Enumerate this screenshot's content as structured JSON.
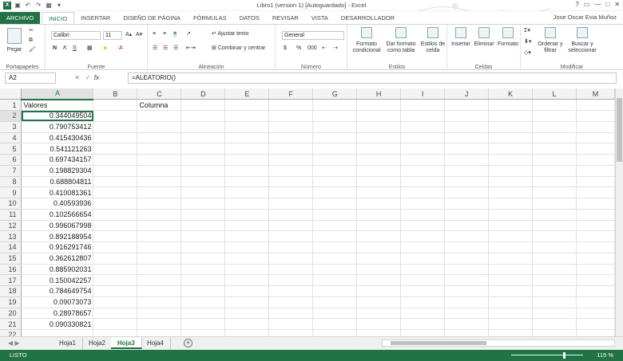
{
  "window": {
    "title": "Libro1 (version 1) [Autoguardado] - Excel",
    "user": "Jose Oscar Evia Muñoz",
    "controls": [
      "?",
      "▭",
      "—",
      "□",
      "✕"
    ]
  },
  "quick_access": [
    "excel-icon",
    "save-icon",
    "undo-icon",
    "redo-icon",
    "table-icon",
    "customize-icon"
  ],
  "ribbon_tabs": [
    "ARCHIVO",
    "INICIO",
    "INSERTAR",
    "DISEÑO DE PÁGINA",
    "FÓRMULAS",
    "DATOS",
    "REVISAR",
    "VISTA",
    "DESARROLLADOR"
  ],
  "ribbon": {
    "clipboard": {
      "label": "Portapapeles",
      "paste": "Pegar"
    },
    "font": {
      "label": "Fuente",
      "name": "Calibri",
      "size": "11",
      "bold": "N",
      "italic": "K",
      "underline": "S"
    },
    "alignment": {
      "label": "Alineación",
      "wrap": "Ajustar texto",
      "merge": "Combinar y centrar"
    },
    "number": {
      "label": "Número",
      "format": "General",
      "currency": "$",
      "percent": "%",
      "thousands": "000"
    },
    "styles": {
      "label": "Estilos",
      "conditional": "Formato condicional",
      "as_table": "Dar formato como tabla",
      "cell_styles": "Estilos de celda"
    },
    "cells": {
      "label": "Celdas",
      "insert": "Insertar",
      "delete": "Eliminar",
      "format": "Formato"
    },
    "editing": {
      "label": "Modificar",
      "sort": "Ordenar y filtrar",
      "find": "Buscar y seleccionar"
    }
  },
  "formula_bar": {
    "name_box": "A2",
    "fx": "fx",
    "formula": "=ALEATORIO()"
  },
  "columns": [
    "A",
    "B",
    "C",
    "D",
    "E",
    "F",
    "G",
    "H",
    "I",
    "J",
    "K",
    "L",
    "M"
  ],
  "rows": [
    {
      "n": "1",
      "a": "Valores",
      "c": "Columna"
    },
    {
      "n": "2",
      "a": "0.344049504",
      "c": ""
    },
    {
      "n": "3",
      "a": "0.790753412",
      "c": ""
    },
    {
      "n": "4",
      "a": "0.415430436",
      "c": ""
    },
    {
      "n": "5",
      "a": "0.541121263",
      "c": ""
    },
    {
      "n": "6",
      "a": "0.697434157",
      "c": ""
    },
    {
      "n": "7",
      "a": "0.198829304",
      "c": ""
    },
    {
      "n": "8",
      "a": "0.688804811",
      "c": ""
    },
    {
      "n": "9",
      "a": "0.410081361",
      "c": ""
    },
    {
      "n": "10",
      "a": "0.40593936",
      "c": ""
    },
    {
      "n": "11",
      "a": "0.102566654",
      "c": ""
    },
    {
      "n": "12",
      "a": "0.996067998",
      "c": ""
    },
    {
      "n": "13",
      "a": "0.892188954",
      "c": ""
    },
    {
      "n": "14",
      "a": "0.916291746",
      "c": ""
    },
    {
      "n": "15",
      "a": "0.362612807",
      "c": ""
    },
    {
      "n": "16",
      "a": "0.885902031",
      "c": ""
    },
    {
      "n": "17",
      "a": "0.150042257",
      "c": ""
    },
    {
      "n": "18",
      "a": "0.784649754",
      "c": ""
    },
    {
      "n": "19",
      "a": "0.09073073",
      "c": ""
    },
    {
      "n": "20",
      "a": "0.28978657",
      "c": ""
    },
    {
      "n": "21",
      "a": "0.090330821",
      "c": ""
    },
    {
      "n": "22",
      "a": "",
      "c": ""
    }
  ],
  "sheets": [
    "Hoja1",
    "Hoja2",
    "Hoja3",
    "Hoja4"
  ],
  "active_sheet": "Hoja3",
  "status": {
    "ready": "LISTO",
    "zoom": "115 %"
  },
  "colors": {
    "accent": "#217346",
    "statusbar": "#217346"
  }
}
